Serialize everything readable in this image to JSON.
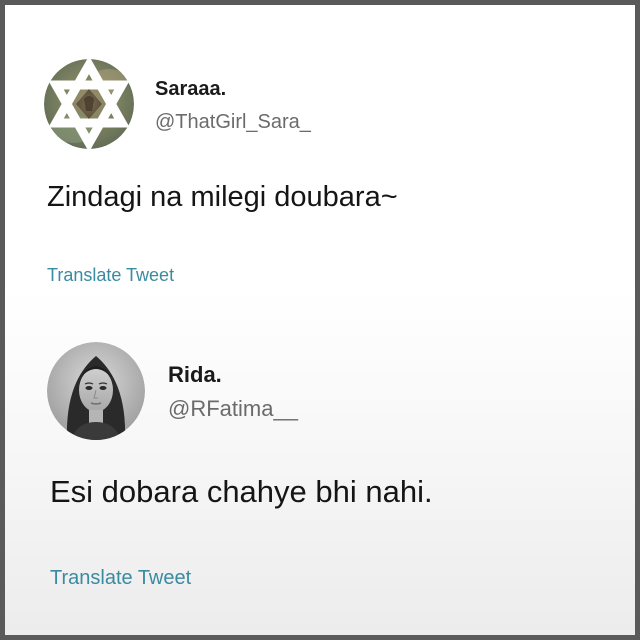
{
  "tweets": [
    {
      "display_name": "Saraaa.",
      "handle": "@ThatGirl_Sara_",
      "text": "Zindagi na milegi doubara~",
      "translate_label": "Translate Tweet",
      "avatar_icon": "star-of-david-icon"
    },
    {
      "display_name": "Rida.",
      "handle": "@RFatima__",
      "text": "Esi dobara chahye bhi nahi.",
      "translate_label": "Translate Tweet",
      "avatar_icon": "portrait-photo"
    }
  ],
  "colors": {
    "link": "#3a8aa0",
    "handle": "#6b6b6b",
    "frame": "#5a5a5a"
  }
}
